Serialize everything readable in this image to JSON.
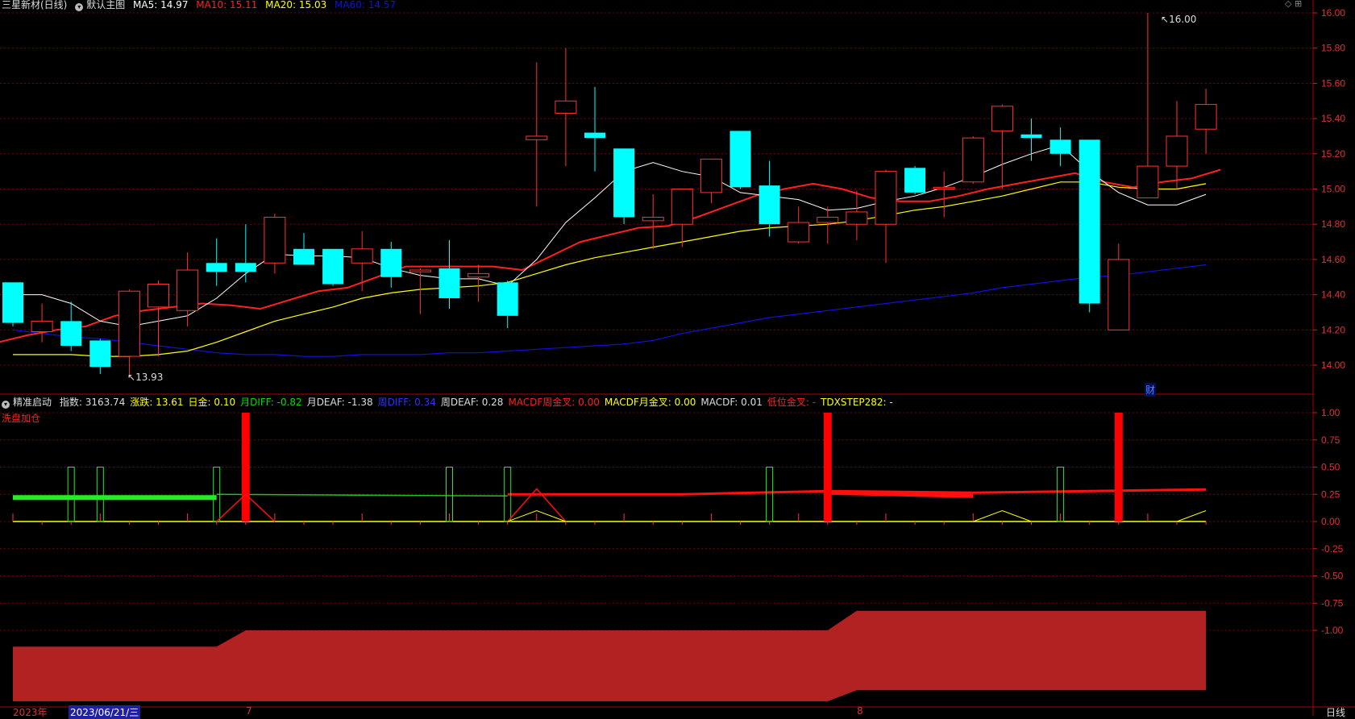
{
  "main_header": {
    "stock": "三星新材(日线)",
    "template": "默认主图",
    "ma5": "MA5: 14.97",
    "ma10": "MA10: 15.11",
    "ma20": "MA20: 15.03",
    "ma60": "MA60: 14.57"
  },
  "sub_header": {
    "name": "精准启动",
    "items": [
      {
        "text": "指数: 3163.74",
        "color": "#dddddd"
      },
      {
        "text": "涨跌: 13.61",
        "color": "#ffff00"
      },
      {
        "text": "日金: 0.10",
        "color": "#ffff00"
      },
      {
        "text": "月DIFF: -0.82",
        "color": "#00dd00"
      },
      {
        "text": "月DEAF: -1.38",
        "color": "#dddddd"
      },
      {
        "text": "周DIFF: 0.34",
        "color": "#3030ff"
      },
      {
        "text": "周DEAF: 0.28",
        "color": "#dddddd"
      },
      {
        "text": "MACDF周金叉: 0.00",
        "color": "#ff2020"
      },
      {
        "text": "MACDF月金叉: 0.00",
        "color": "#ffff00"
      },
      {
        "text": "MACDF: 0.01",
        "color": "#dddddd"
      },
      {
        "text": "低位金叉: -",
        "color": "#ff2020"
      },
      {
        "text": "TDXSTEP282: -",
        "color": "#ffff00"
      }
    ],
    "second_line": "洗盘加仓"
  },
  "annotations": {
    "high": "16.00",
    "low": "13.93",
    "finance_marker": "财"
  },
  "bottom_axis": {
    "year": "2023年",
    "cursor_date": "2023/06/21/三",
    "month_jul": "7",
    "month_aug": "8",
    "period": "日线"
  },
  "colors": {
    "up": "#ff3232",
    "down": "#00ffff",
    "ma5": "#ffffff",
    "ma10": "#ff2020",
    "ma20": "#ffff00",
    "ma60": "#1010e0",
    "grid": "#800000"
  },
  "chart_data": {
    "type": "candlestick",
    "price_axis": {
      "range": [
        13.88,
        16.08
      ],
      "ticks": [
        "16.00",
        "15.80",
        "15.60",
        "15.40",
        "15.20",
        "15.00",
        "14.80",
        "14.60",
        "14.40",
        "14.20",
        "14.00"
      ]
    },
    "candles": [
      {
        "o": 14.47,
        "h": 14.47,
        "l": 14.22,
        "c": 14.24
      },
      {
        "o": 14.19,
        "h": 14.35,
        "l": 14.13,
        "c": 14.25
      },
      {
        "o": 14.25,
        "h": 14.36,
        "l": 14.08,
        "c": 14.11
      },
      {
        "o": 14.14,
        "h": 14.15,
        "l": 13.95,
        "c": 13.99
      },
      {
        "o": 14.05,
        "h": 14.43,
        "l": 13.93,
        "c": 14.42
      },
      {
        "o": 14.33,
        "h": 14.48,
        "l": 14.05,
        "c": 14.46
      },
      {
        "o": 14.31,
        "h": 14.64,
        "l": 14.22,
        "c": 14.54
      },
      {
        "o": 14.58,
        "h": 14.72,
        "l": 14.45,
        "c": 14.53
      },
      {
        "o": 14.58,
        "h": 14.8,
        "l": 14.47,
        "c": 14.53
      },
      {
        "o": 14.58,
        "h": 14.86,
        "l": 14.52,
        "c": 14.84
      },
      {
        "o": 14.66,
        "h": 14.75,
        "l": 14.57,
        "c": 14.57
      },
      {
        "o": 14.66,
        "h": 14.66,
        "l": 14.45,
        "c": 14.46
      },
      {
        "o": 14.58,
        "h": 14.76,
        "l": 14.42,
        "c": 14.66
      },
      {
        "o": 14.66,
        "h": 14.7,
        "l": 14.44,
        "c": 14.5
      },
      {
        "o": 14.53,
        "h": 14.55,
        "l": 14.29,
        "c": 14.54
      },
      {
        "o": 14.55,
        "h": 14.71,
        "l": 14.32,
        "c": 14.38
      },
      {
        "o": 14.5,
        "h": 14.57,
        "l": 14.36,
        "c": 14.52
      },
      {
        "o": 14.47,
        "h": 14.48,
        "l": 14.21,
        "c": 14.28
      },
      {
        "o": 15.28,
        "h": 15.72,
        "l": 14.9,
        "c": 15.3
      },
      {
        "o": 15.43,
        "h": 15.8,
        "l": 15.13,
        "c": 15.5
      },
      {
        "o": 15.32,
        "h": 15.58,
        "l": 15.1,
        "c": 15.29
      },
      {
        "o": 15.23,
        "h": 15.23,
        "l": 14.8,
        "c": 14.84
      },
      {
        "o": 14.82,
        "h": 14.97,
        "l": 14.66,
        "c": 14.84
      },
      {
        "o": 14.8,
        "h": 15.0,
        "l": 14.67,
        "c": 15.0
      },
      {
        "o": 14.98,
        "h": 15.17,
        "l": 14.92,
        "c": 15.17
      },
      {
        "o": 15.33,
        "h": 15.33,
        "l": 15.0,
        "c": 15.01
      },
      {
        "o": 15.02,
        "h": 15.16,
        "l": 14.73,
        "c": 14.8
      },
      {
        "o": 14.7,
        "h": 14.9,
        "l": 14.69,
        "c": 14.81
      },
      {
        "o": 14.81,
        "h": 14.9,
        "l": 14.69,
        "c": 14.84
      },
      {
        "o": 14.8,
        "h": 14.99,
        "l": 14.71,
        "c": 14.87
      },
      {
        "o": 14.8,
        "h": 15.11,
        "l": 14.58,
        "c": 15.1
      },
      {
        "o": 15.12,
        "h": 15.13,
        "l": 14.97,
        "c": 14.98
      },
      {
        "o": 15.0,
        "h": 15.1,
        "l": 14.84,
        "c": 15.01
      },
      {
        "o": 15.04,
        "h": 15.3,
        "l": 15.03,
        "c": 15.29
      },
      {
        "o": 15.33,
        "h": 15.48,
        "l": 15.0,
        "c": 15.47
      },
      {
        "o": 15.31,
        "h": 15.4,
        "l": 15.16,
        "c": 15.29
      },
      {
        "o": 15.28,
        "h": 15.35,
        "l": 15.13,
        "c": 15.2
      },
      {
        "o": 15.28,
        "h": 15.28,
        "l": 14.3,
        "c": 14.35
      },
      {
        "o": 14.2,
        "h": 14.69,
        "l": 14.2,
        "c": 14.6
      },
      {
        "o": 14.95,
        "h": 16.0,
        "l": 14.95,
        "c": 15.13
      },
      {
        "o": 15.13,
        "h": 15.5,
        "l": 15.0,
        "c": 15.3
      },
      {
        "o": 15.34,
        "h": 15.57,
        "l": 15.2,
        "c": 15.48
      }
    ],
    "ma5": [
      14.4,
      14.4,
      14.35,
      14.25,
      14.22,
      14.25,
      14.28,
      14.38,
      14.52,
      14.63,
      14.62,
      14.62,
      14.61,
      14.55,
      14.51,
      14.49,
      14.49,
      14.45,
      14.6,
      14.81,
      14.95,
      15.1,
      15.15,
      15.1,
      15.07,
      14.98,
      14.96,
      14.94,
      14.88,
      14.89,
      14.93,
      14.96,
      15.01,
      15.07,
      15.14,
      15.2,
      15.25,
      15.1,
      14.98,
      14.91,
      14.91,
      14.97
    ],
    "ma10": [
      14.13,
      14.17,
      14.2,
      14.22,
      14.28,
      14.31,
      14.33,
      14.35,
      14.34,
      14.32,
      14.37,
      14.42,
      14.44,
      14.5,
      14.56,
      14.56,
      14.56,
      14.56,
      14.54,
      14.62,
      14.7,
      14.74,
      14.78,
      14.79,
      14.84,
      14.9,
      14.96,
      15.0,
      15.03,
      15.0,
      14.95,
      14.93,
      14.93,
      14.96,
      15.0,
      15.03,
      15.06,
      15.09,
      15.04,
      15.01,
      15.04,
      15.06,
      15.11
    ],
    "ma20": [
      14.06,
      14.06,
      14.06,
      14.05,
      14.05,
      14.06,
      14.08,
      14.13,
      14.19,
      14.25,
      14.29,
      14.33,
      14.38,
      14.41,
      14.43,
      14.44,
      14.45,
      14.47,
      14.52,
      14.57,
      14.61,
      14.64,
      14.67,
      14.7,
      14.73,
      14.76,
      14.78,
      14.79,
      14.8,
      14.82,
      14.85,
      14.88,
      14.9,
      14.93,
      14.96,
      15.0,
      15.04,
      15.04,
      15.01,
      15.0,
      15.0,
      15.03
    ],
    "ma60": [
      14.2,
      14.18,
      14.16,
      14.15,
      14.13,
      14.11,
      14.09,
      14.07,
      14.06,
      14.06,
      14.05,
      14.05,
      14.06,
      14.06,
      14.06,
      14.07,
      14.07,
      14.08,
      14.09,
      14.1,
      14.11,
      14.12,
      14.14,
      14.18,
      14.21,
      14.24,
      14.27,
      14.29,
      14.31,
      14.33,
      14.35,
      14.37,
      14.39,
      14.41,
      14.44,
      14.46,
      14.48,
      14.5,
      14.51,
      14.53,
      14.55,
      14.57
    ],
    "indicator_axis": {
      "range": [
        -1.3,
        1.08
      ],
      "ticks": [
        "1.00",
        "0.75",
        "0.50",
        "0.25",
        "0.00",
        "-0.25",
        "-0.50",
        "-0.75",
        "-1.00"
      ]
    }
  }
}
